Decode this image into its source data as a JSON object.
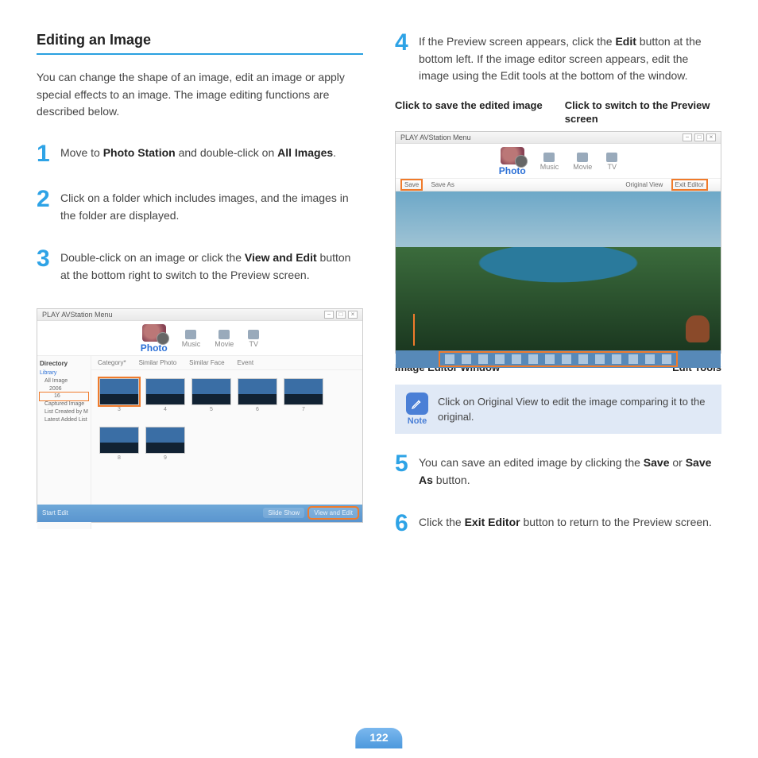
{
  "page_number": "122",
  "heading": "Editing an Image",
  "intro": "You can change the shape of an image, edit an image or apply special effects to an image. The image editing functions are described below.",
  "steps": {
    "s1": {
      "num": "1",
      "pre": "Move to ",
      "b1": "Photo Station",
      "mid": " and double-click on ",
      "b2": "All Images",
      "post": "."
    },
    "s2": {
      "num": "2",
      "text": "Click on a folder which includes images, and the images in the folder are displayed."
    },
    "s3": {
      "num": "3",
      "pre": "Double-click on an image or click the ",
      "b1": "View and Edit",
      "post": " button at the bottom right to switch to the Preview screen."
    },
    "s4": {
      "num": "4",
      "pre": "If the Preview screen appears, click the ",
      "b1": "Edit",
      "post": " button at the bottom left. If the image editor screen appears, edit the image using the Edit tools at the bottom of the window."
    },
    "s5": {
      "num": "5",
      "pre": "You can save an edited image by clicking the ",
      "b1": "Save",
      "mid": " or ",
      "b2": "Save As",
      "post": " button."
    },
    "s6": {
      "num": "6",
      "pre": "Click the ",
      "b1": "Exit Editor",
      "post": " button to return to the Preview screen."
    }
  },
  "annotations": {
    "save_label": "Click to save the edited image",
    "preview_label": "Click to switch to the Preview screen",
    "image_editor_window": "Image Editor Window",
    "edit_tools": "Edit Tools"
  },
  "note": {
    "label": "Note",
    "text": "Click on Original View to edit the image comparing it to the original."
  },
  "app": {
    "title": "PLAY AVStation   Menu",
    "tabs": {
      "photo": "Photo",
      "music": "Music",
      "movie": "Movie",
      "tv": "TV"
    },
    "ss1": {
      "side_header": "Directory",
      "side_items": [
        "Library",
        "All Image",
        "2006",
        "16",
        "Captured Image",
        "List Created by M",
        "Latest Added List"
      ],
      "main_tabs": [
        "Category*",
        "Similar Photo",
        "Similar Face",
        "Event"
      ],
      "thumb_nums_row1": [
        "3",
        "4",
        "5",
        "6",
        "7"
      ],
      "thumb_nums_row2": [
        "8",
        "9"
      ],
      "bottom_left": "Start Edit",
      "bottom_slide": "Slide Show",
      "bottom_view": "View and Edit"
    },
    "ss2": {
      "toolbar_left": [
        "Save",
        "Save As"
      ],
      "toolbar_right": [
        "Original View",
        "Exit Editor"
      ]
    }
  }
}
